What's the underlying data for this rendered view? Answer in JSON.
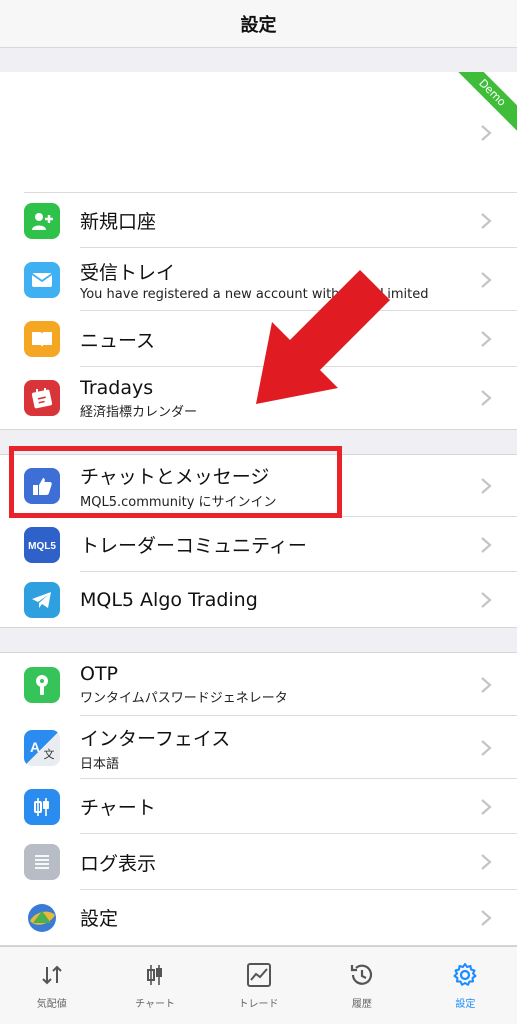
{
  "header": {
    "title": "設定"
  },
  "account": {
    "badge": "Demo"
  },
  "section1": {
    "items": [
      {
        "label": "新規口座",
        "sub": "",
        "icon": "add-user-icon",
        "color": "#2ec24a"
      },
      {
        "label": "受信トレイ",
        "sub": "You have registered a new account with Exfin Limited",
        "icon": "mail-icon",
        "color": "#3fb1f2"
      },
      {
        "label": "ニュース",
        "sub": "",
        "icon": "book-icon",
        "color": "#f5a623"
      },
      {
        "label": "Tradays",
        "sub": "経済指標カレンダー",
        "icon": "calendar-icon",
        "color": "#d9343a"
      }
    ]
  },
  "section2": {
    "items": [
      {
        "label": "チャットとメッセージ",
        "sub": "MQL5.community にサインイン",
        "icon": "thumb-icon",
        "color": "#3e6fd6"
      },
      {
        "label": "トレーダーコミュニティー",
        "sub": "",
        "icon": "mql5-icon",
        "color": "#2f62c9"
      },
      {
        "label": "MQL5 Algo Trading",
        "sub": "",
        "icon": "telegram-icon",
        "color": "#2ea0e0"
      }
    ]
  },
  "section3": {
    "items": [
      {
        "label": "OTP",
        "sub": "ワンタイムパスワードジェネレータ",
        "icon": "key-icon",
        "color": "#36c35a"
      },
      {
        "label": "インターフェイス",
        "sub": "日本語",
        "icon": "translate-icon",
        "color": "#2b8cf0"
      },
      {
        "label": "チャート",
        "sub": "",
        "icon": "candles-icon",
        "color": "#2b8cf0"
      },
      {
        "label": "ログ表示",
        "sub": "",
        "icon": "log-icon",
        "color": "#b8bcc4"
      },
      {
        "label": "設定",
        "sub": "",
        "icon": "mt-logo-icon",
        "color": "#ffffff"
      }
    ]
  },
  "tabbar": {
    "tabs": [
      {
        "label": "気配値",
        "icon": "quotes-icon",
        "active": false
      },
      {
        "label": "チャート",
        "icon": "chart-icon",
        "active": false
      },
      {
        "label": "トレード",
        "icon": "trade-icon",
        "active": false
      },
      {
        "label": "履歴",
        "icon": "history-icon",
        "active": false
      },
      {
        "label": "設定",
        "icon": "settings-icon",
        "active": true
      }
    ]
  },
  "colors": {
    "accent": "#1a8cff",
    "highlight": "#e8232a",
    "arrow": "#e11b22"
  }
}
